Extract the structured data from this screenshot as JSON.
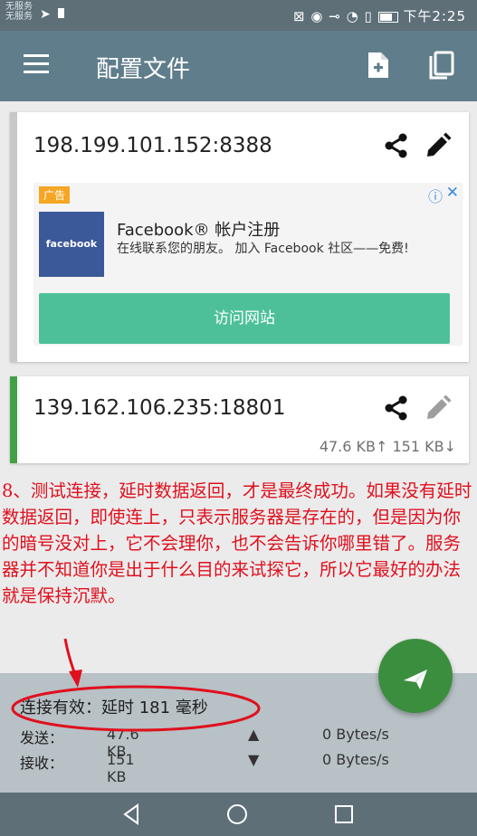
{
  "status_bar": {
    "carrier_line1": "无服务",
    "carrier_line2": "无服务",
    "time": "下午2:25"
  },
  "app_bar": {
    "title": "配置文件",
    "icons": [
      "menu-icon",
      "add-file-icon",
      "copy-icon"
    ]
  },
  "profiles": [
    {
      "server": "198.199.101.152:8388",
      "selected": false
    },
    {
      "server": "139.162.106.235:18801",
      "selected": true,
      "tx": "47.6 KB↑",
      "rx": "151 KB↓"
    }
  ],
  "ad": {
    "badge": "广告",
    "info_icon": "ⓘ",
    "close_icon": "✕",
    "logo_text": "facebook",
    "title": "Facebook® 帐户注册",
    "description": "在线联系您的朋友。 加入 Facebook 社区——免费!",
    "cta": "访问网站"
  },
  "annotation": "8、测试连接，延时数据返回，才是最终成功。如果没有延时数据返回，即使连上，只表示服务器是存在的，但是因为你的暗号没对上，它不会理你，也不会告诉你哪里错了。服务器并不知道你是出于什么目的来试探它，所以它最好的办法就是保持沉默。",
  "stats": {
    "status": "连接有效：延时 181 毫秒",
    "send_label": "发送：",
    "send_value": "47.6 KB",
    "send_arrow": "▲",
    "send_rate": "0 Bytes/s",
    "recv_label": "接收：",
    "recv_value": "151 KB",
    "recv_arrow": "▼",
    "recv_rate": "0 Bytes/s"
  },
  "colors": {
    "app_bar": "#607d8b",
    "accent": "#43a047",
    "annotation": "#e0101e"
  }
}
